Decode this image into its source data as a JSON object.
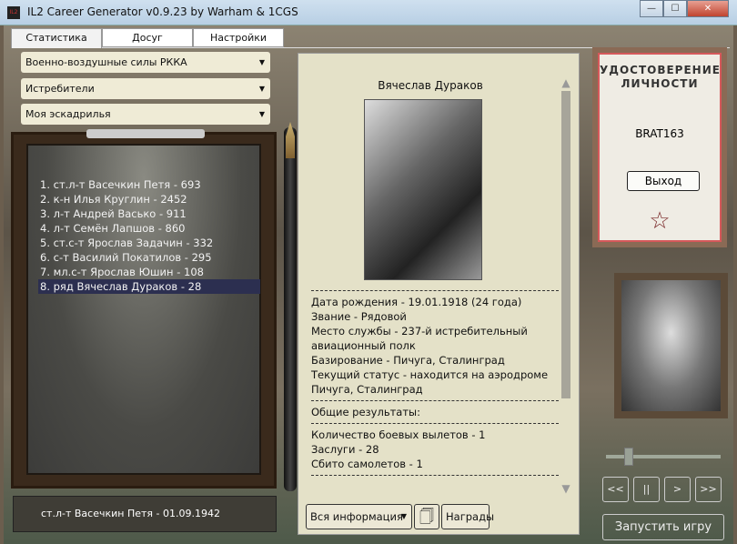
{
  "window": {
    "title": "IL2 Career Generator v0.9.23 by Warham & 1CGS",
    "app_icon": "IL2",
    "min": "—",
    "max": "☐",
    "close": "✕"
  },
  "tabs": [
    "Статистика",
    "Досуг",
    "Настройки"
  ],
  "selects": {
    "air_force": "Военно-воздушные силы РККА",
    "branch": "Истребители",
    "squadron": "Моя эскадрилья"
  },
  "pilots": [
    "1. ст.л-т Васечкин Петя - 693",
    "2. к-н Илья Круглин - 2452",
    "3. л-т Андрей Васько - 911",
    "4. л-т Семён Лапшов - 860",
    "5. ст.с-т Ярослав Задачин - 332",
    "6. с-т Василий Покатилов - 295",
    "7. мл.с-т Ярослав Юшин - 108",
    "8. ряд Вячеслав Дураков - 28"
  ],
  "selected_pilot_index": 7,
  "footer_status": "ст.л-т Васечкин Петя - 01.09.1942",
  "profile": {
    "name": "Вячеслав Дураков",
    "details": [
      "Дата рождения - 19.01.1918 (24 года)",
      "Звание - Рядовой",
      "Место службы - 237-й истребительный авиационный полк",
      "Базирование - Пичуга, Сталинград",
      "Текущий статус - находится на аэродроме Пичуга, Сталинград"
    ],
    "results_header": "Общие результаты:",
    "results": [
      "Количество боевых вылетов - 1",
      "Заслуги - 28",
      "Сбито самолетов - 1"
    ]
  },
  "bottom": {
    "filter": "Вся информация",
    "awards": "Награды"
  },
  "idcard": {
    "title": "УДОСТОВЕРЕНИЕ ЛИЧНОСТИ",
    "login": "BRAT163",
    "exit": "Выход"
  },
  "player": {
    "volume_percent": 20,
    "prev": "<<",
    "pause": "||",
    "next": ">",
    "fwd": ">>",
    "run": "Запустить игру"
  }
}
